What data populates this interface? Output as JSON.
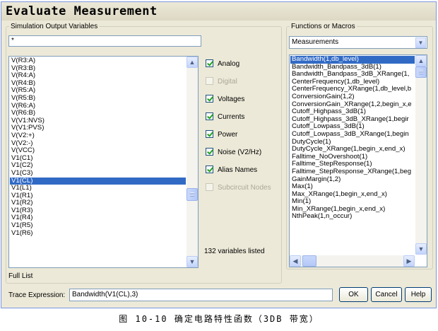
{
  "window": {
    "title": "Evaluate Measurement"
  },
  "left_group": {
    "legend": "Simulation Output Variables",
    "filter_value": "*",
    "variables": [
      "V(R3:A)",
      "V(R3:B)",
      "V(R4:A)",
      "V(R4:B)",
      "V(R5:A)",
      "V(R5:B)",
      "V(R6:A)",
      "V(R6:B)",
      "V(V1:NVS)",
      "V(V1:PVS)",
      "V(V2:+)",
      "V(V2:-)",
      "V(VCC)",
      "V1(C1)",
      "V1(C2)",
      "V1(C3)",
      "V1(CL)",
      "V1(L1)",
      "V1(R1)",
      "V1(R2)",
      "V1(R3)",
      "V1(R4)",
      "V1(R5)",
      "V1(R6)"
    ],
    "selected_variable": "V1(CL)",
    "filter_options": [
      {
        "label": "Analog",
        "checked": true,
        "enabled": true
      },
      {
        "label": "Digital",
        "checked": false,
        "enabled": false
      },
      {
        "label": "Voltages",
        "checked": true,
        "enabled": true
      },
      {
        "label": "Currents",
        "checked": true,
        "enabled": true
      },
      {
        "label": "Power",
        "checked": true,
        "enabled": true
      },
      {
        "label": "Noise (V2/Hz)",
        "checked": true,
        "enabled": true
      },
      {
        "label": "Alias Names",
        "checked": true,
        "enabled": true
      },
      {
        "label": "Subcircuit Nodes",
        "checked": false,
        "enabled": false
      }
    ],
    "count_text": "132 variables listed",
    "list_mode": "Full List"
  },
  "right_group": {
    "legend": "Functions or Macros",
    "dropdown_value": "Measurements",
    "functions": [
      "Bandwidth(1,db_level)",
      "Bandwidth_Bandpass_3dB(1)",
      "Bandwidth_Bandpass_3dB_XRange(1,",
      "CenterFrequency(1,db_level)",
      "CenterFrequency_XRange(1,db_level,b",
      "ConversionGain(1,2)",
      "ConversionGain_XRange(1,2,begin_x,e",
      "Cutoff_Highpass_3dB(1)",
      "Cutoff_Highpass_3dB_XRange(1,begir",
      "Cutoff_Lowpass_3dB(1)",
      "Cutoff_Lowpass_3dB_XRange(1,begin",
      "DutyCycle(1)",
      "DutyCycle_XRange(1,begin_x,end_x)",
      "Falltime_NoOvershoot(1)",
      "Falltime_StepResponse(1)",
      "Falltime_StepResponse_XRange(1,beg",
      "GainMargin(1,2)",
      "Max(1)",
      "Max_XRange(1,begin_x,end_x)",
      "Min(1)",
      "Min_XRange(1,begin_x,end_x)",
      "NthPeak(1,n_occur)"
    ],
    "selected_function": "Bandwidth(1,db_level)"
  },
  "trace_expression": {
    "label": "Trace Expression:",
    "value": "Bandwidth(V1(CL),3)"
  },
  "buttons": {
    "ok": "OK",
    "cancel": "Cancel",
    "help": "Help"
  },
  "caption": "图 10-10 确定电路特性函数（3DB 带宽）"
}
